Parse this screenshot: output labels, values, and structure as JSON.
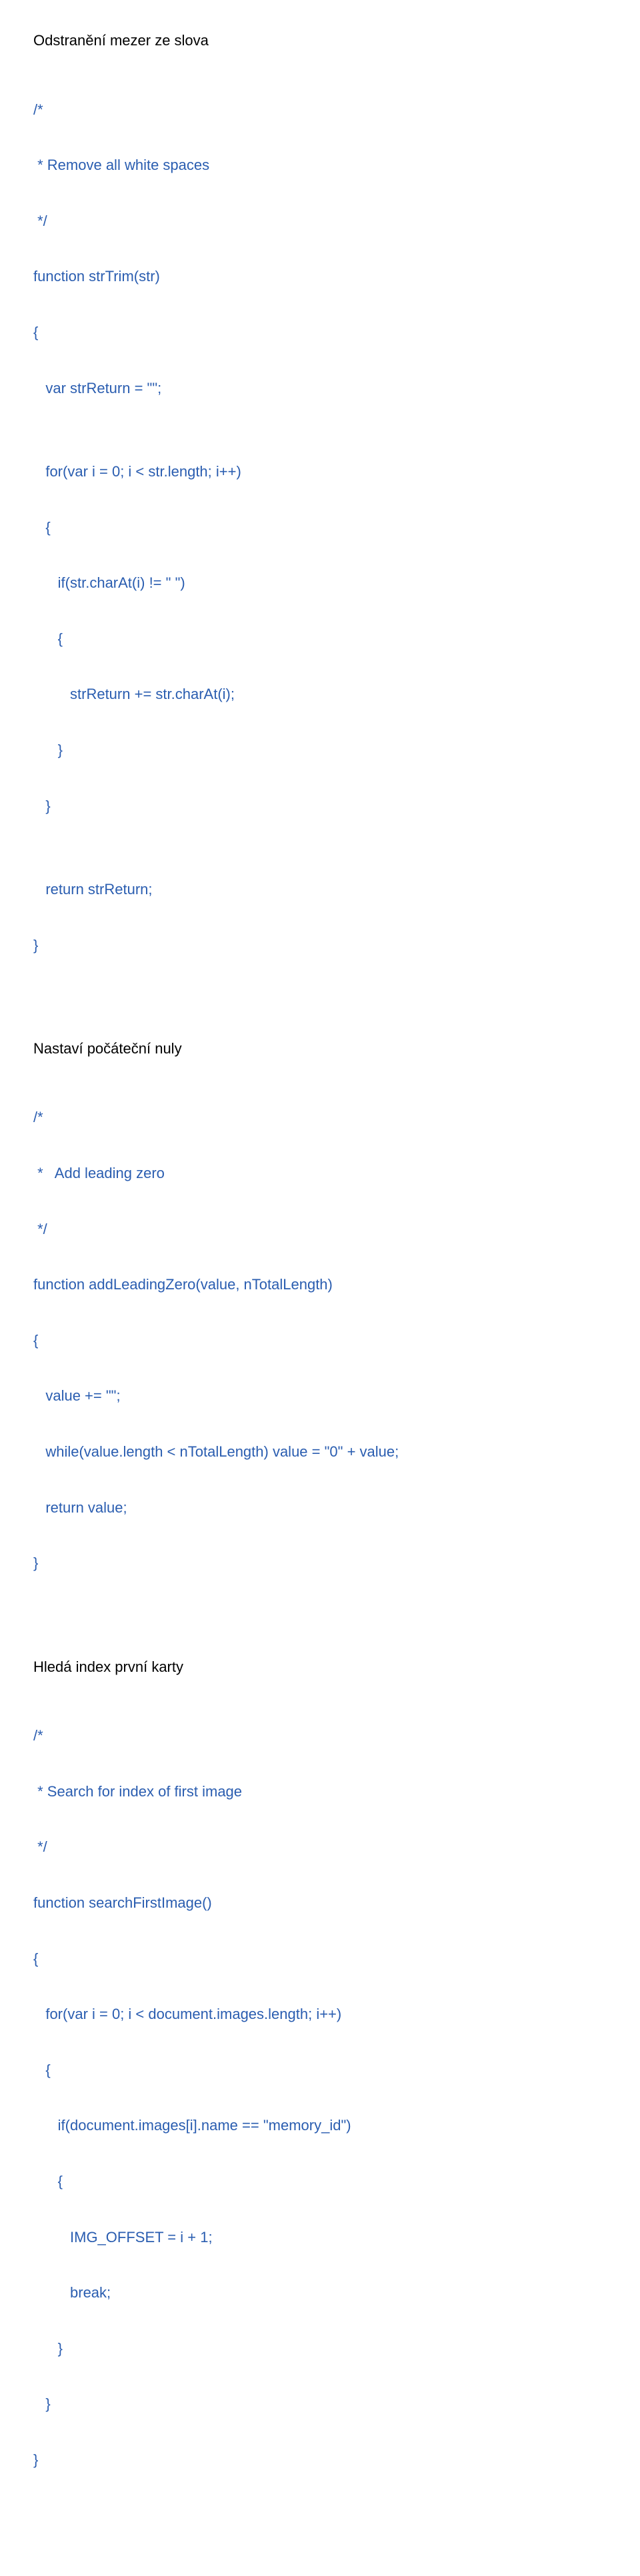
{
  "section1": {
    "heading": "Odstranění mezer ze slova",
    "line1": "/*",
    "line2": " * Remove all white spaces",
    "line3": " */",
    "line4": "function strTrim(str)",
    "line5": "{",
    "line6": "   var strReturn = \"\";",
    "line7": "",
    "line8": "   for(var i = 0; i < str.length; i++)",
    "line9": "   {",
    "line10": "      if(str.charAt(i) != \" \")",
    "line11": "      {",
    "line12": "         strReturn += str.charAt(i);",
    "line13": "      }",
    "line14": "   }",
    "line15": "",
    "line16": "   return strReturn;",
    "line17": "}"
  },
  "section2": {
    "heading": "Nastaví počáteční nuly",
    "line1": "/*",
    "line2": " *   Add leading zero",
    "line3": " */",
    "line4": "function addLeadingZero(value, nTotalLength)",
    "line5": "{",
    "line6": "   value += \"\";",
    "line7": "   while(value.length < nTotalLength) value = \"0\" + value;",
    "line8": "   return value;",
    "line9": "}"
  },
  "section3": {
    "heading": "Hledá index první karty",
    "line1": "/*",
    "line2": " * Search for index of first image",
    "line3": " */",
    "line4": "function searchFirstImage()",
    "line5": "{",
    "line6": "   for(var i = 0; i < document.images.length; i++)",
    "line7": "   {",
    "line8": "      if(document.images[i].name == \"memory_id\")",
    "line9": "      {",
    "line10": "         IMG_OFFSET = i + 1;",
    "line11": "         break;",
    "line12": "      }",
    "line13": "   }",
    "line14": "}"
  }
}
